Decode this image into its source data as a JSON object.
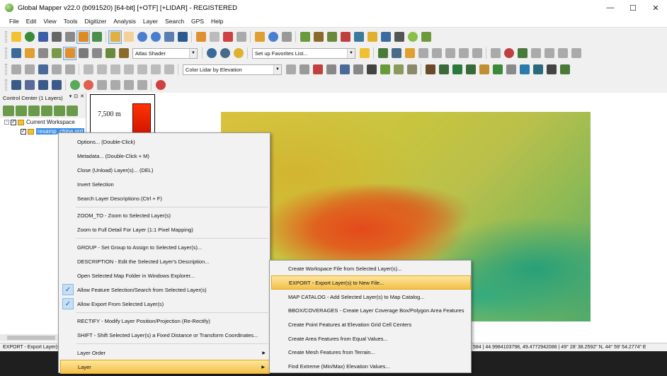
{
  "window": {
    "title": "Global Mapper v22.0 (b091520) [64-bit] [+OTF] [+LIDAR] - REGISTERED",
    "minimize": "—",
    "maximize": "☐",
    "close": "✕"
  },
  "menubar": [
    "File",
    "Edit",
    "View",
    "Tools",
    "Digitizer",
    "Analysis",
    "Layer",
    "Search",
    "GPS",
    "Help"
  ],
  "toolbars": {
    "shader_combo": "Atlas Shader",
    "favorites_combo": "Set up Favorites List...",
    "lidar_combo": "Color Lidar by Elevation",
    "combo_arrow": "▼"
  },
  "control_center": {
    "title": "Control Center (1 Layers)",
    "header_buttons": [
      "▾",
      "⊡",
      "✕"
    ],
    "expander": "−",
    "check": "✓",
    "workspace_label": "Current Workspace",
    "layer_label": "resamp_china.grd"
  },
  "legend": {
    "label": "7,500 m"
  },
  "status": {
    "left": "EXPORT - Export Layer(s)",
    "right": "584 | 44.9984103798, 49.4772942086 | 49° 28' 38.2592\" N, 44° 59' 54.2774\" E"
  },
  "context_menu": {
    "items": [
      {
        "label": "Options... (Double-Click)"
      },
      {
        "label": "Metadata... (Double-Click + M)"
      },
      {
        "label": "Close (Unload) Layer(s)... (DEL)"
      },
      {
        "label": "Invert Selection"
      },
      {
        "label": "Search Layer Descriptions (Ctrl + F)"
      },
      {
        "label": "ZOOM_TO - Zoom to Selected Layer(s)"
      },
      {
        "label": "Zoom to Full Detail For Layer (1:1 Pixel Mapping)"
      },
      {
        "label": "GROUP - Set Group to Assign to Selected Layer(s)..."
      },
      {
        "label": "DESCRIPTION - Edit the Selected Layer's Description..."
      },
      {
        "label": "Open Selected Map Folder in Windows Explorer..."
      },
      {
        "label": "Allow Feature Selection/Search from Selected Layer(s)",
        "checked": true
      },
      {
        "label": "Allow Export From Selected Layer(s)",
        "checked": true
      },
      {
        "label": "RECTIFY - Modify Layer Position/Projection (Re-Rectify)"
      },
      {
        "label": "SHIFT - Shift Selected Layer(s) a Fixed Distance or Transform Coordinates..."
      },
      {
        "label": "Layer Order"
      },
      {
        "label": "Layer"
      }
    ],
    "check_mark": "✓",
    "submenu_arrow": "▶"
  },
  "sub_menu": {
    "items": [
      {
        "label": "Create Workspace File from Selected Layer(s)..."
      },
      {
        "label": "EXPORT - Export Layer(s) to New File..."
      },
      {
        "label": "MAP CATALOG - Add Selected Layer(s) to Map Catalog..."
      },
      {
        "label": "BBOX/COVERAGES  - Create Layer Coverage Box/Polygon Area Features"
      },
      {
        "label": "Create Point Features at Elevation Grid Cell Centers"
      },
      {
        "label": "Create Area Features from Equal Values..."
      },
      {
        "label": "Create Mesh Features from Terrain..."
      },
      {
        "label": "Find Extreme (Min/Max) Elevation Values..."
      }
    ]
  },
  "colors": {
    "selection": "#3b8fe3",
    "menu_highlight": "#f4c04a",
    "legend_bar": "#ff3300"
  }
}
